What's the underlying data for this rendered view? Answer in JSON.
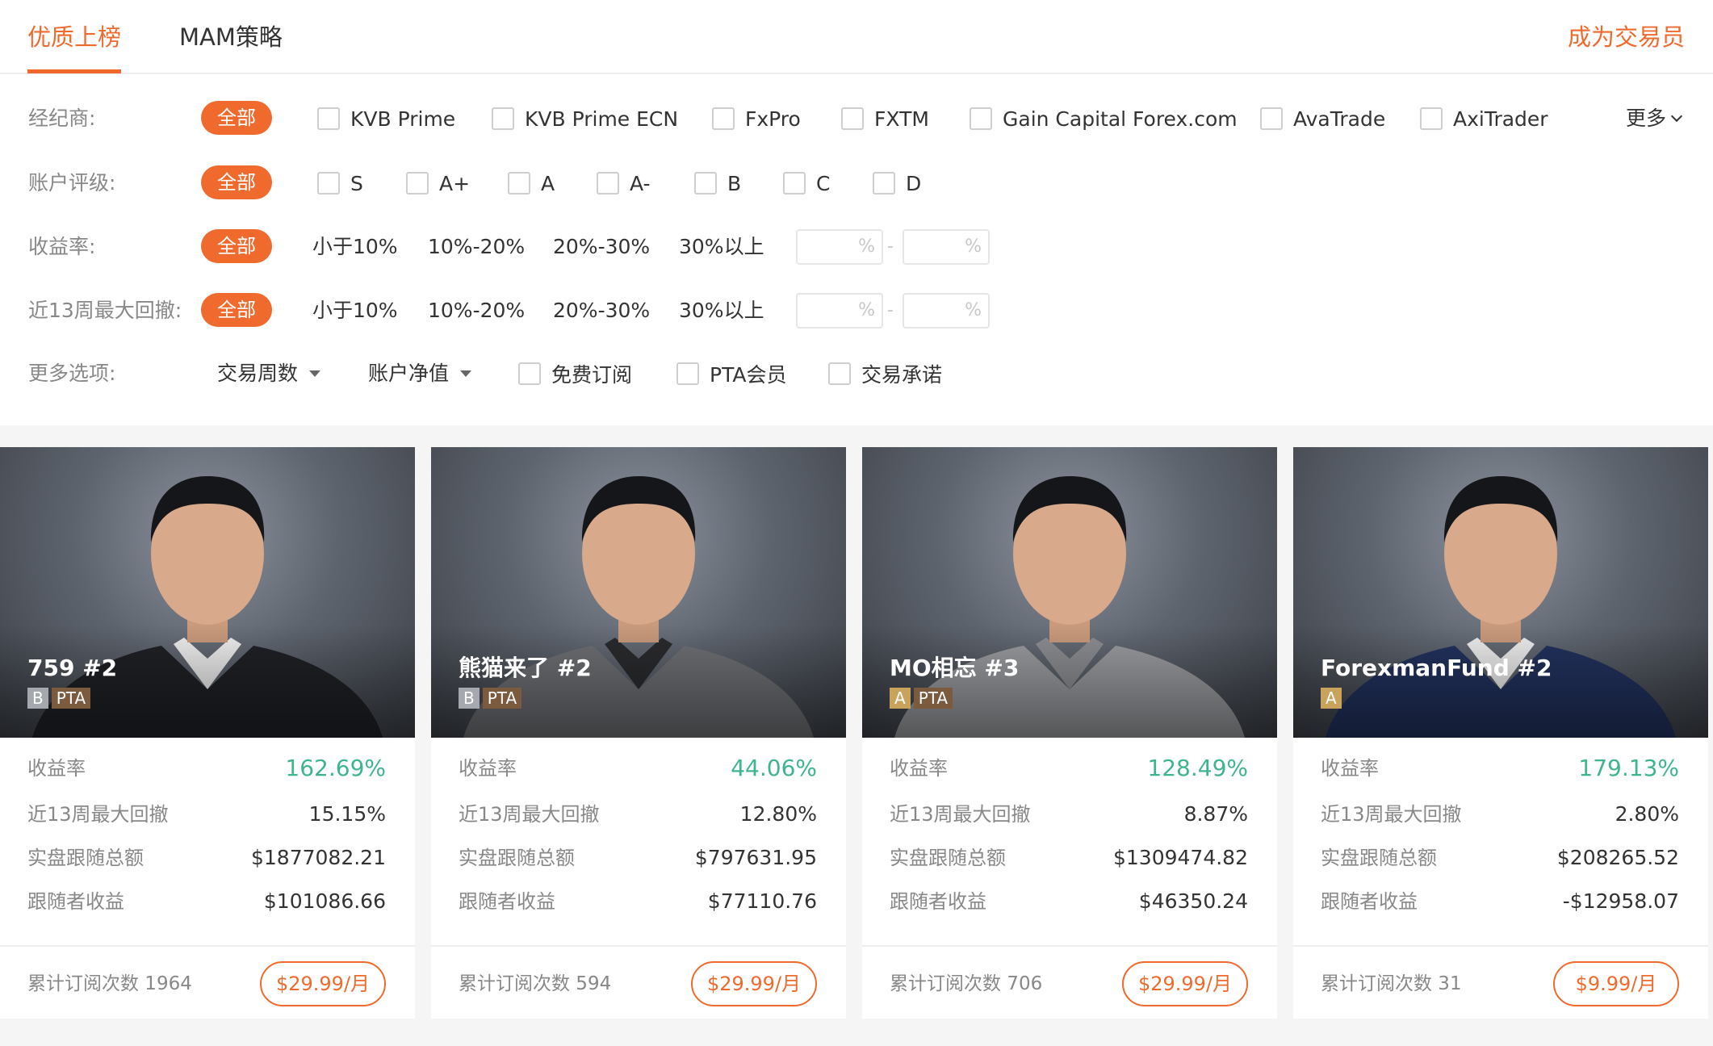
{
  "tabs": [
    {
      "label": "优质上榜",
      "active": true
    },
    {
      "label": "MAM策略",
      "active": false
    }
  ],
  "become_trader": "成为交易员",
  "filters": {
    "broker": {
      "label": "经纪商:",
      "all": "全部",
      "options": [
        "KVB Prime",
        "KVB Prime ECN",
        "FxPro",
        "FXTM",
        "Gain Capital Forex.com",
        "AvaTrade",
        "AxiTrader"
      ],
      "more": "更多"
    },
    "rating": {
      "label": "账户评级:",
      "all": "全部",
      "options": [
        "S",
        "A+",
        "A",
        "A-",
        "B",
        "C",
        "D"
      ]
    },
    "return_rate": {
      "label": "收益率:",
      "all": "全部",
      "options": [
        "小于10%",
        "10%-20%",
        "20%-30%",
        "30%以上"
      ],
      "min_placeholder": "%",
      "separator": "-",
      "max_placeholder": "%"
    },
    "drawdown": {
      "label": "近13周最大回撤:",
      "all": "全部",
      "options": [
        "小于10%",
        "10%-20%",
        "20%-30%",
        "30%以上"
      ],
      "min_placeholder": "%",
      "separator": "-",
      "max_placeholder": "%"
    },
    "more_options": {
      "label": "更多选项:",
      "dropdowns": [
        "交易周数",
        "账户净值"
      ],
      "checkboxes": [
        "免费订阅",
        "PTA会员",
        "交易承诺"
      ]
    }
  },
  "stat_labels": {
    "return_rate": "收益率",
    "drawdown": "近13周最大回撤",
    "follow_total": "实盘跟随总额",
    "follower_profit": "跟随者收益",
    "subscriptions": "累计订阅次数"
  },
  "colors": {
    "accent": "#f06a2d",
    "positive": "#3fb58d",
    "grade_b": "#a5a8ae",
    "grade_a": "#c9a25c",
    "pta": "#7b5a3d"
  },
  "cards": [
    {
      "name": "759 #2",
      "grade": "B",
      "pta": "PTA",
      "return_rate": "162.69%",
      "drawdown": "15.15%",
      "follow_total": "$1877082.21",
      "follower_profit": "$101086.66",
      "subscriptions": "1964",
      "price": "$29.99/月",
      "photo_icon": "trader-portrait"
    },
    {
      "name": "熊猫来了 #2",
      "grade": "B",
      "pta": "PTA",
      "return_rate": "44.06%",
      "drawdown": "12.80%",
      "follow_total": "$797631.95",
      "follower_profit": "$77110.76",
      "subscriptions": "594",
      "price": "$29.99/月",
      "photo_icon": "trader-portrait"
    },
    {
      "name": "MO相忘 #3",
      "grade": "A",
      "pta": "PTA",
      "return_rate": "128.49%",
      "drawdown": "8.87%",
      "follow_total": "$1309474.82",
      "follower_profit": "$46350.24",
      "subscriptions": "706",
      "price": "$29.99/月",
      "photo_icon": "trader-portrait"
    },
    {
      "name": "ForexmanFund #2",
      "grade": "A",
      "pta": null,
      "return_rate": "179.13%",
      "drawdown": "2.80%",
      "follow_total": "$208265.52",
      "follower_profit": "-$12958.07",
      "subscriptions": "31",
      "price": "$9.99/月",
      "photo_icon": "trader-portrait"
    }
  ]
}
